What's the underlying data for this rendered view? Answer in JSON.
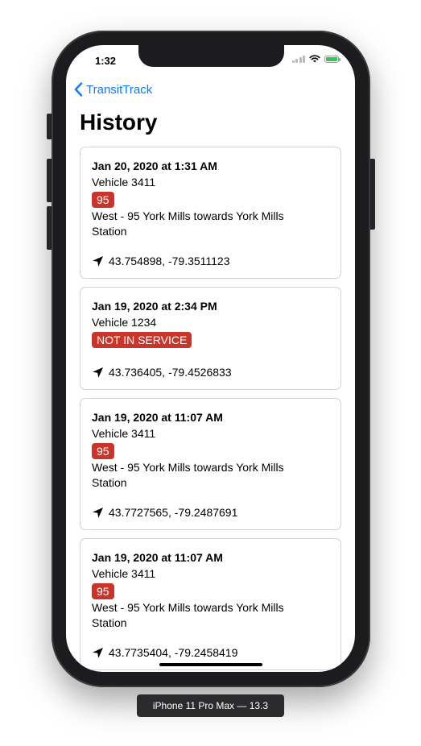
{
  "status_bar": {
    "time": "1:32"
  },
  "nav": {
    "back_label": "TransitTrack",
    "title": "History"
  },
  "history": [
    {
      "date": "Jan 20, 2020 at 1:31 AM",
      "vehicle": "Vehicle 3411",
      "route": "95",
      "description": "West - 95 York Mills towards York Mills Station",
      "coordinates": "43.754898, -79.3511123"
    },
    {
      "date": "Jan 19, 2020 at 2:34 PM",
      "vehicle": "Vehicle 1234",
      "route": "NOT IN SERVICE",
      "description": "",
      "coordinates": "43.736405, -79.4526833"
    },
    {
      "date": "Jan 19, 2020 at 11:07 AM",
      "vehicle": "Vehicle 3411",
      "route": "95",
      "description": "West - 95 York Mills towards York Mills Station",
      "coordinates": "43.7727565, -79.2487691"
    },
    {
      "date": "Jan 19, 2020 at 11:07 AM",
      "vehicle": "Vehicle 3411",
      "route": "95",
      "description": "West - 95 York Mills towards York Mills Station",
      "coordinates": "43.7735404, -79.2458419"
    }
  ],
  "device_label": "iPhone 11 Pro Max — 13.3",
  "colors": {
    "accent": "#0a7aff",
    "route_badge": "#c8362b"
  },
  "icons": {
    "back": "chevron-left-icon",
    "location": "location-arrow-icon"
  }
}
